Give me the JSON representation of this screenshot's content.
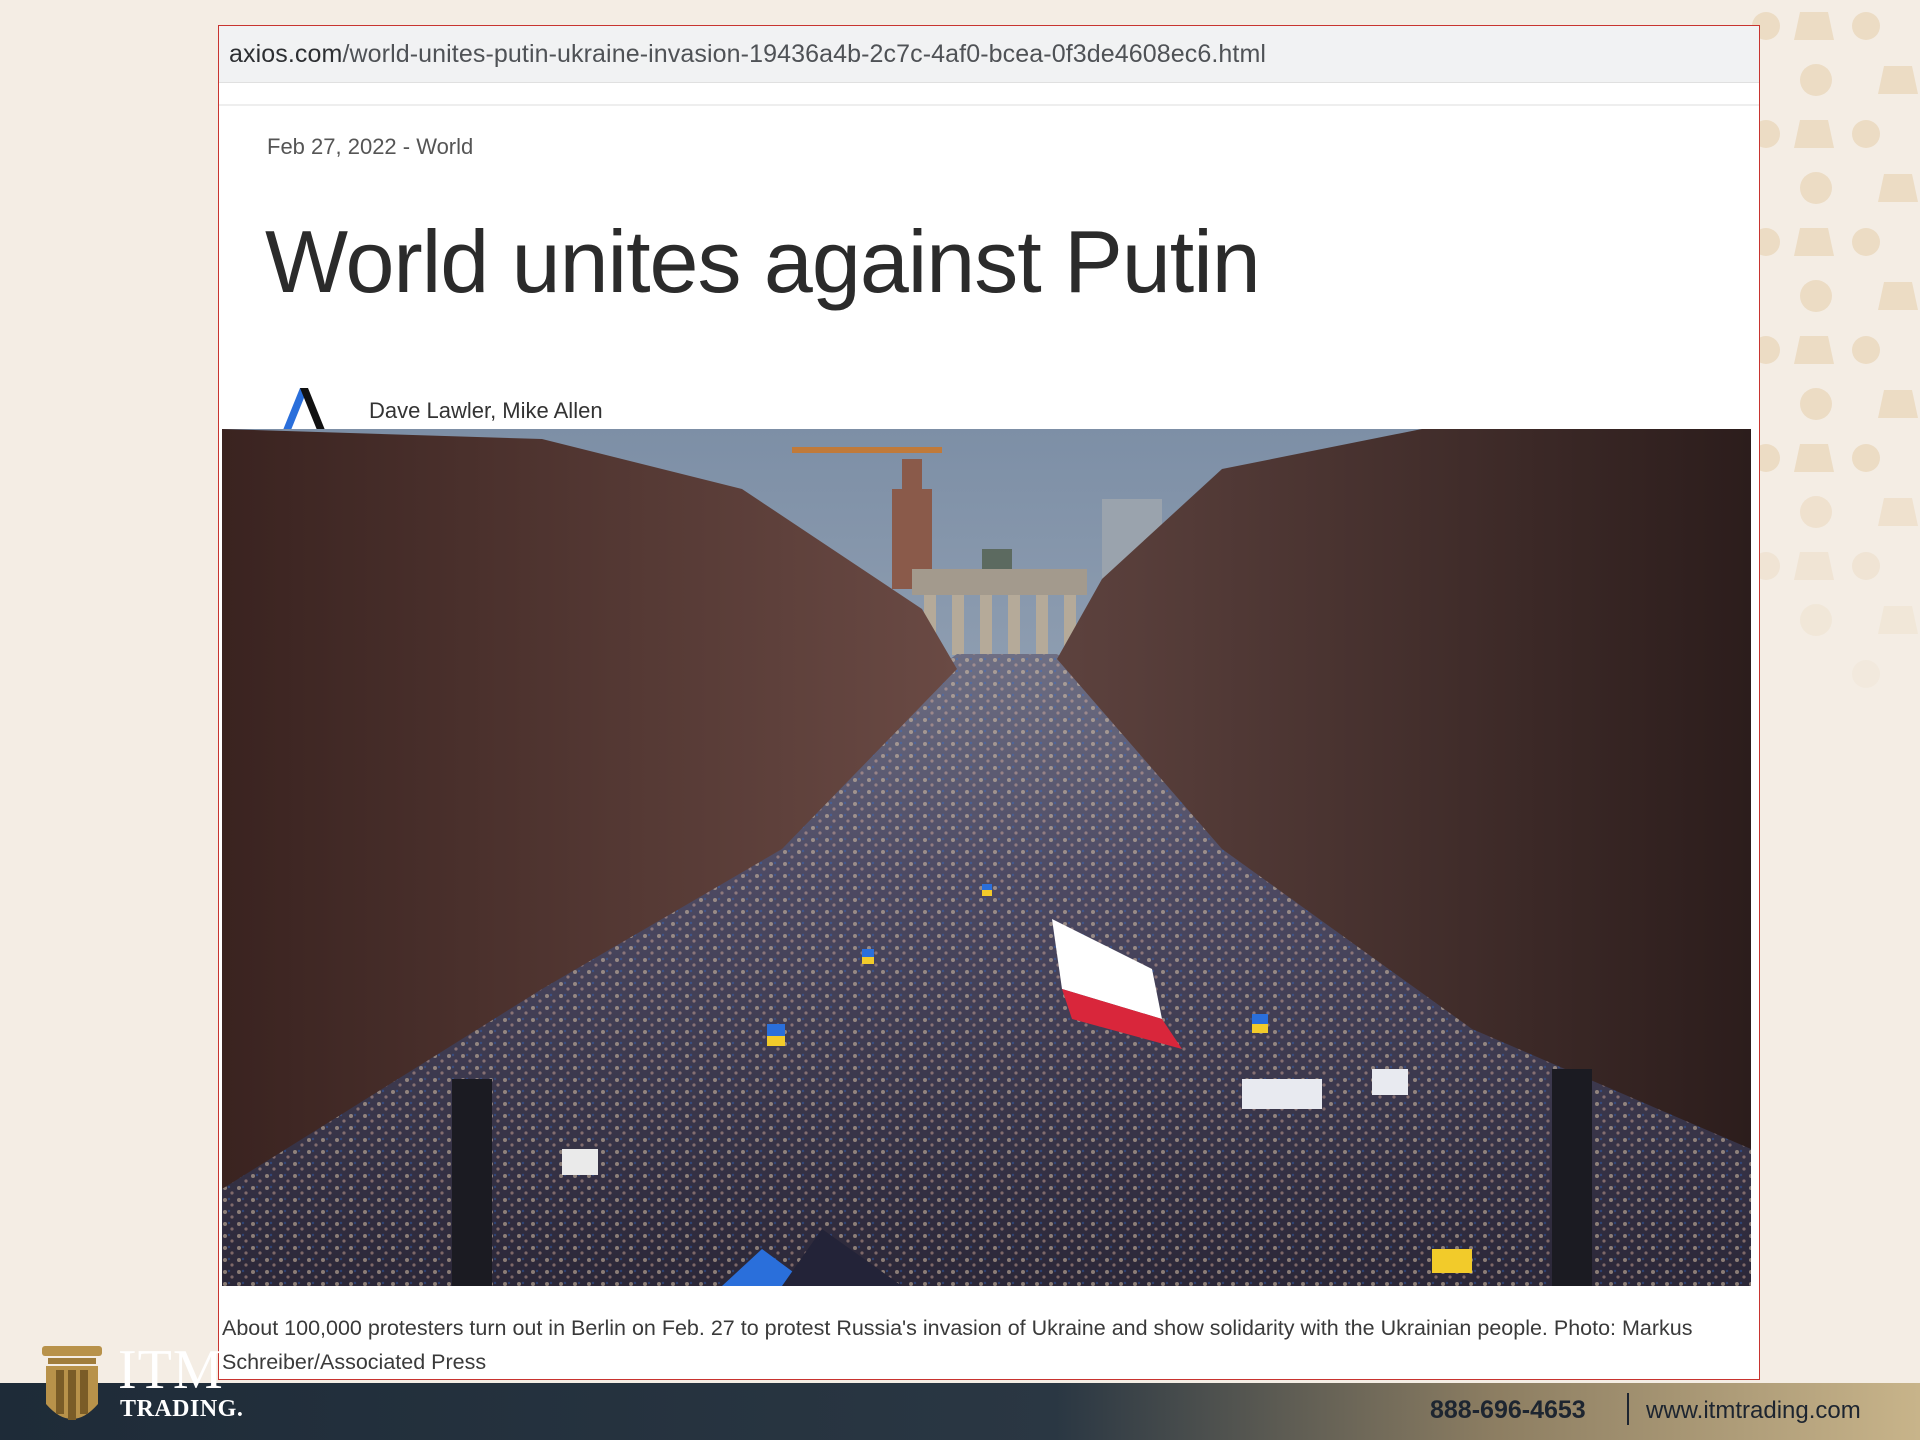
{
  "browser": {
    "url_domain": "axios.com",
    "url_path": "/world-unites-putin-ukraine-invasion-19436a4b-2c7c-4af0-bcea-0f3de4608ec6.html"
  },
  "article": {
    "dateline": "Feb 27, 2022 - World",
    "headline": "World unites against Putin",
    "authors": "Dave Lawler, Mike Allen",
    "photo_description_icon": "protest-crowd-photo",
    "caption": "About 100,000 protesters turn out in Berlin on Feb. 27 to protest Russia's invasion of Ukraine and show solidarity with the Ukrainian people. Photo: Markus Schreiber/Associated Press"
  },
  "footer": {
    "phone": "888-696-4653",
    "website": "www.itmtrading.com"
  },
  "brand": {
    "logo_text": "ITM",
    "logo_subtext": "TRADING.",
    "gold": "#b8924a",
    "navy": "#1e2b38"
  },
  "colors": {
    "panel_border": "#c8342f",
    "axios_blue": "#2a6fdb"
  }
}
